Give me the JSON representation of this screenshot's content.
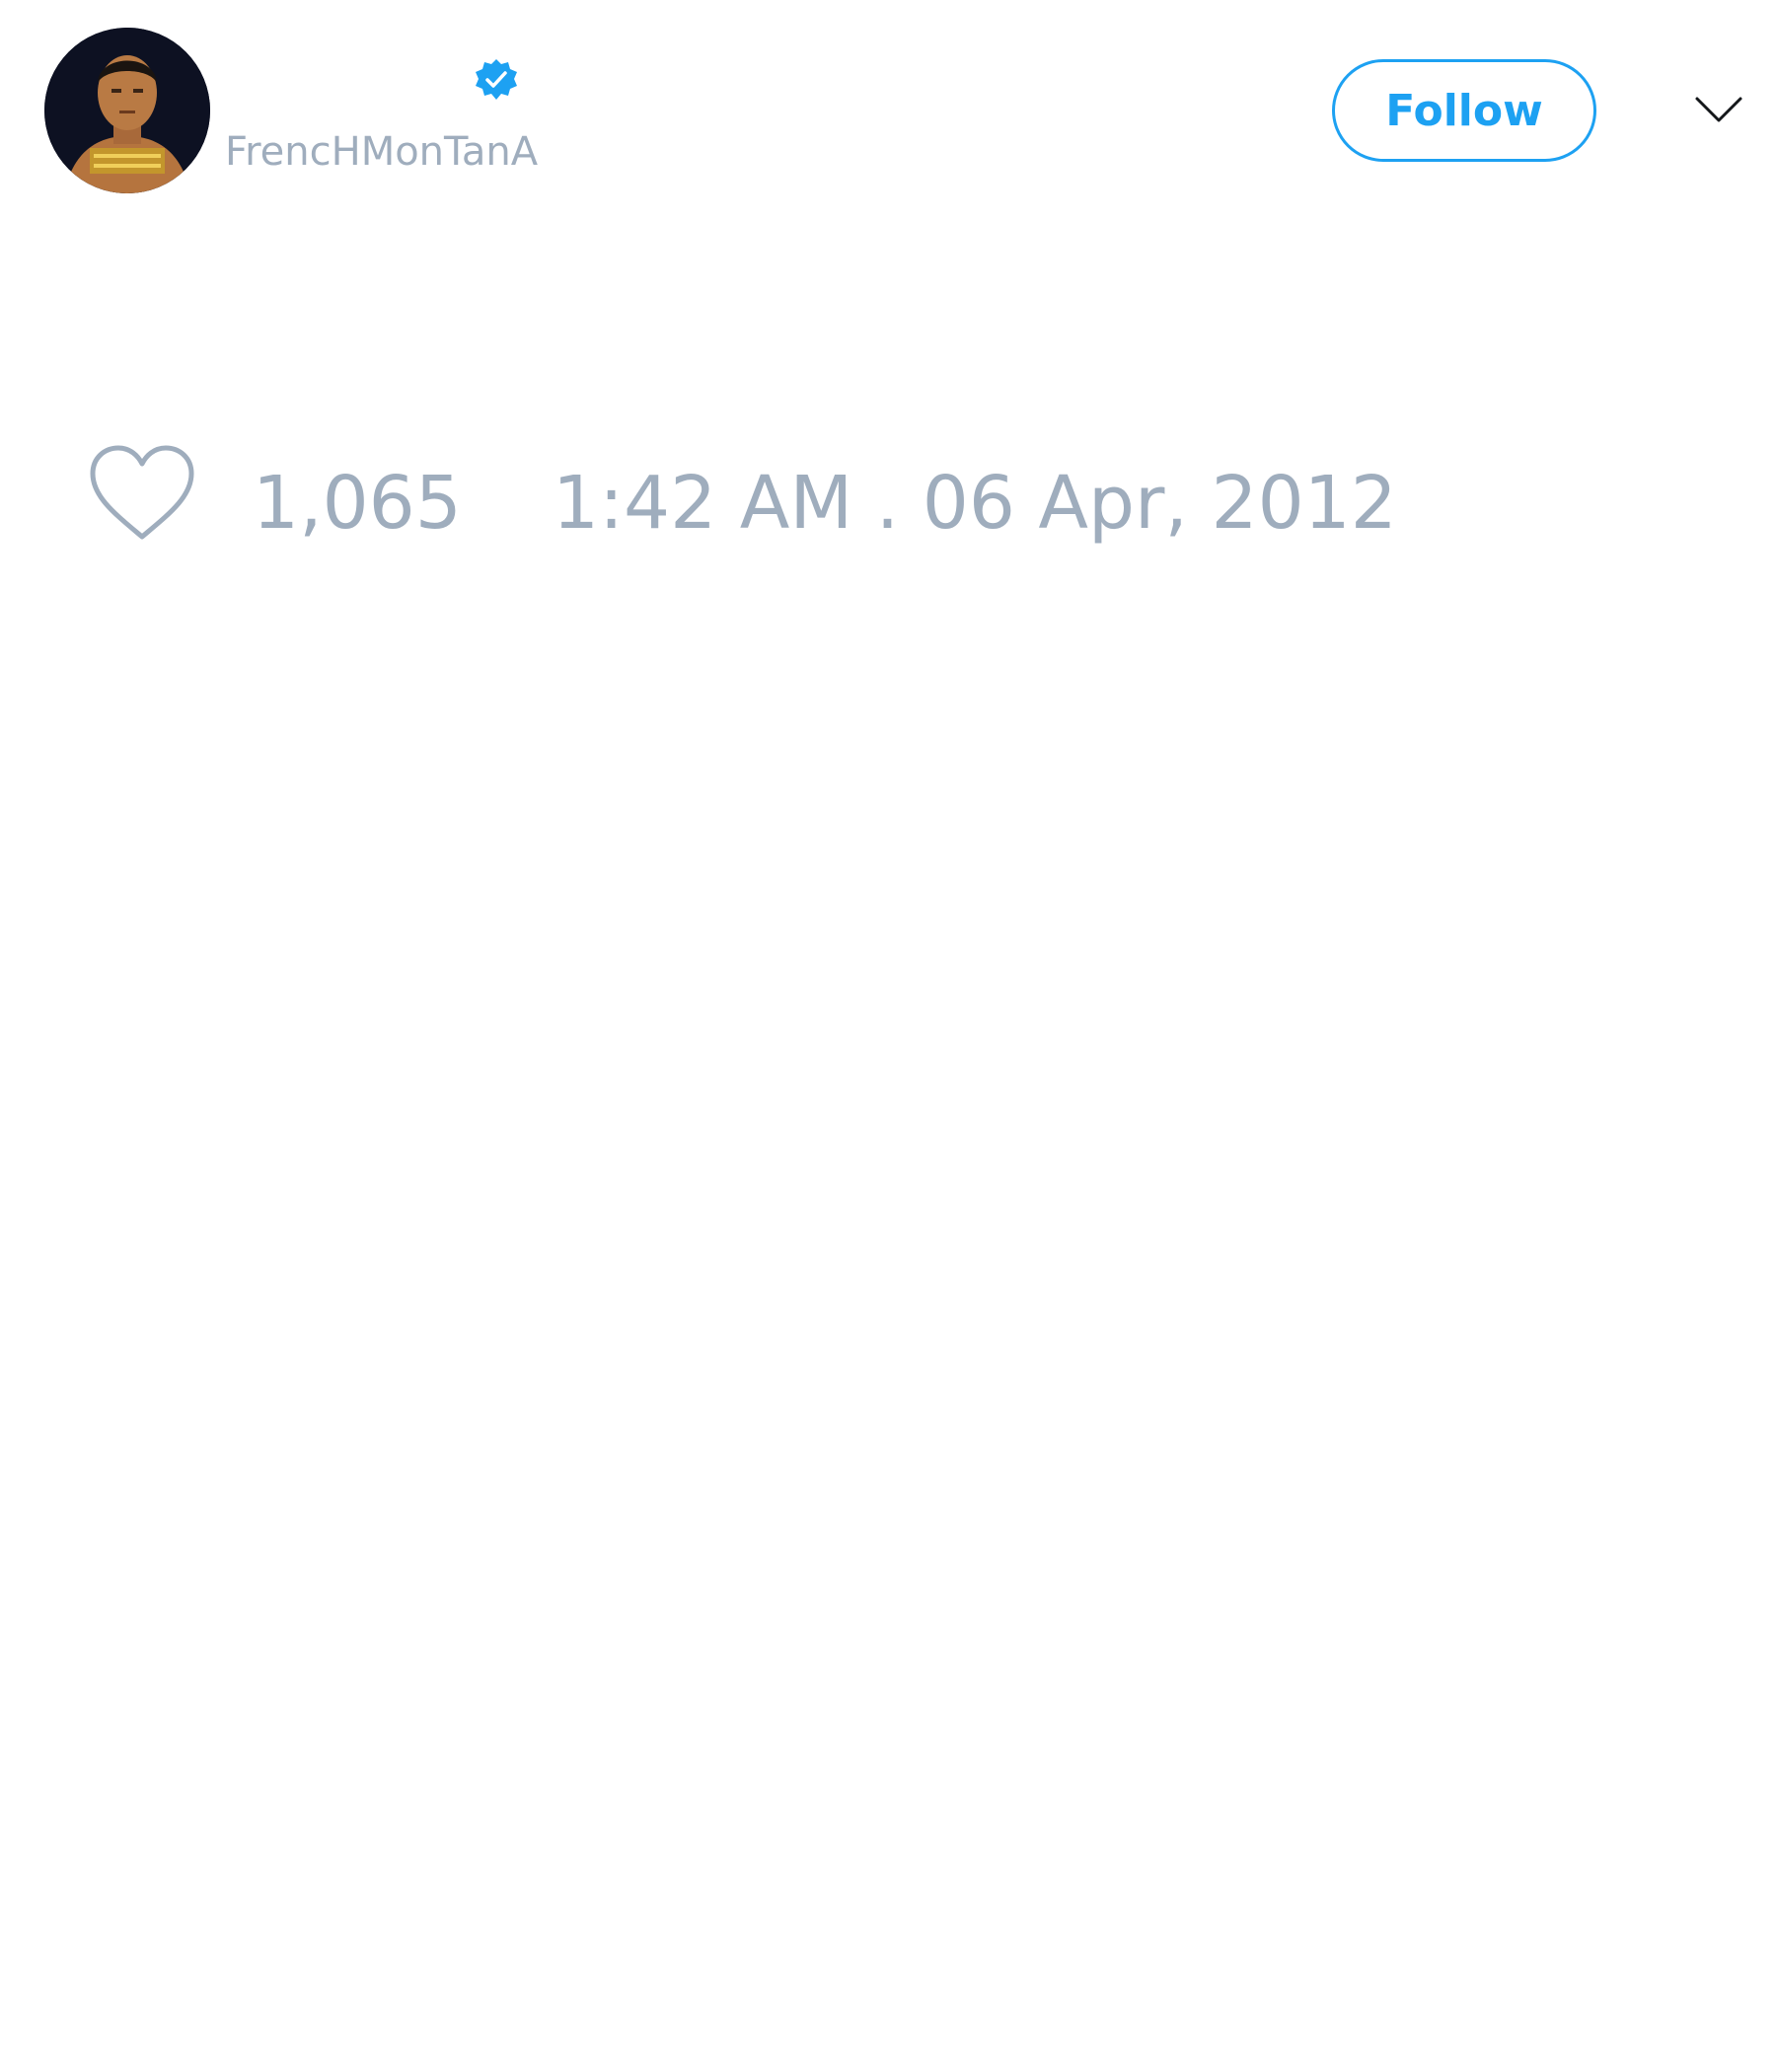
{
  "tweet": {
    "author": {
      "handle": "FrencHMonTanA",
      "verified": true,
      "avatar_icon": "profile-photo"
    },
    "follow_label": "Follow",
    "menu_icon": "chevron-down-icon",
    "likes": {
      "icon": "heart-icon",
      "count": "1,065"
    },
    "timestamp": "1:42 AM . 06 Apr, 2012"
  },
  "colors": {
    "accent": "#1da1f2",
    "muted_text": "#9fadbd",
    "background": "#ffffff"
  }
}
